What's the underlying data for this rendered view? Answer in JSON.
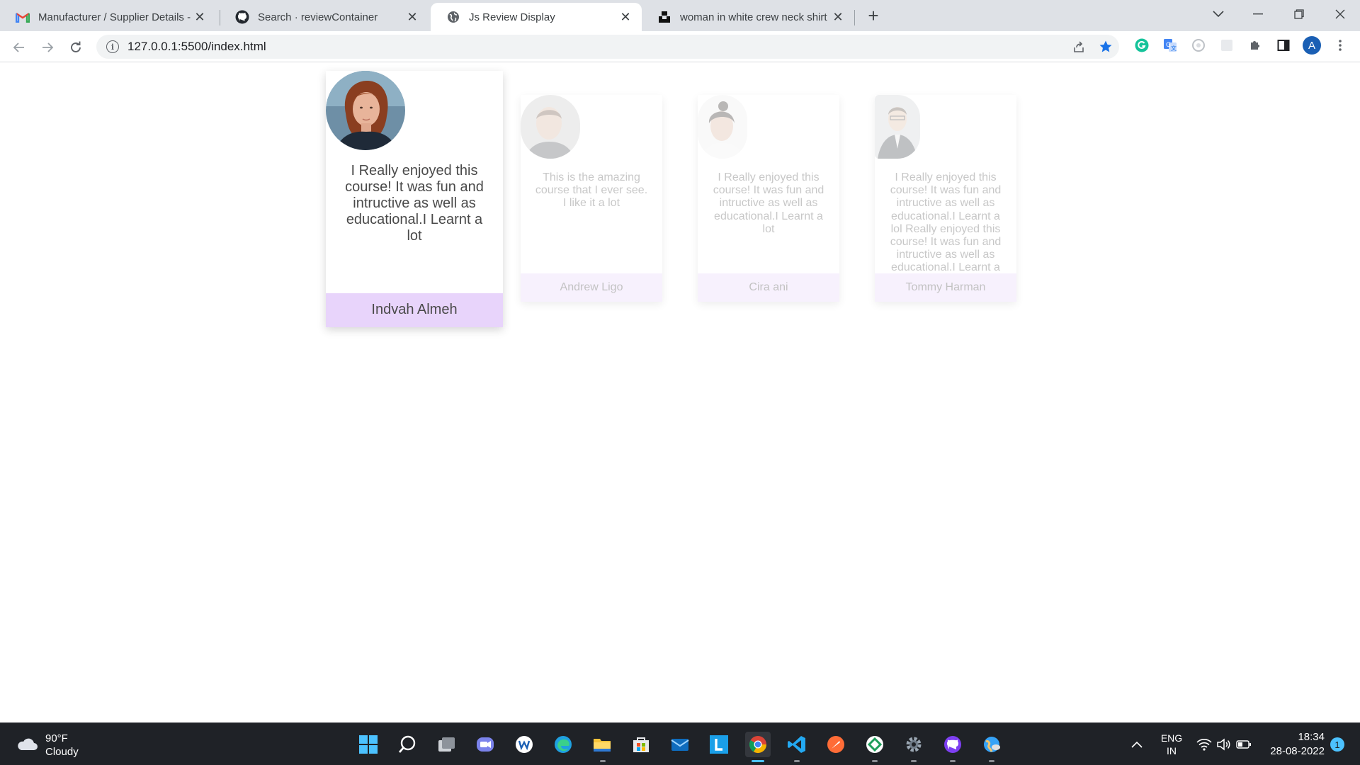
{
  "browser": {
    "tabs": [
      {
        "title": "Manufacturer / Supplier Details -",
        "icon": "gmail-icon"
      },
      {
        "title": "Search · reviewContainer",
        "icon": "github-icon"
      },
      {
        "title": "Js Review Display",
        "icon": "globe-icon",
        "active": true
      },
      {
        "title": "woman in white crew neck shirt s",
        "icon": "unsplash-icon"
      }
    ],
    "address": "127.0.0.1:5500/index.html",
    "profile_initial": "A"
  },
  "reviews": [
    {
      "name": "Indvah Almeh",
      "text": "I Really enjoyed this course! It was fun and intructive as well as educational.I Learnt a lot",
      "active": true
    },
    {
      "name": "Andrew Ligo",
      "text": "This is the amazing course that I ever see. I like it a lot"
    },
    {
      "name": "Cira ani",
      "text": "I Really enjoyed this course! It was fun and intructive as well as educational.I Learnt a lot"
    },
    {
      "name": "Tommy Harman",
      "text": "I Really enjoyed this course! It was fun and intructive as well as educational.I Learnt a lol Really enjoyed this course! It was fun and intructive as well as educational.I Learnt a"
    }
  ],
  "taskbar": {
    "weather_temp": "90°F",
    "weather_desc": "Cloudy",
    "lang_top": "ENG",
    "lang_bottom": "IN",
    "time": "18:34",
    "date": "28-08-2022",
    "notification_count": "1"
  },
  "colors": {
    "card_name_bg": "#e8d4fb",
    "taskbar_bg": "#1f2227",
    "tabstrip_bg": "#dee1e6"
  }
}
